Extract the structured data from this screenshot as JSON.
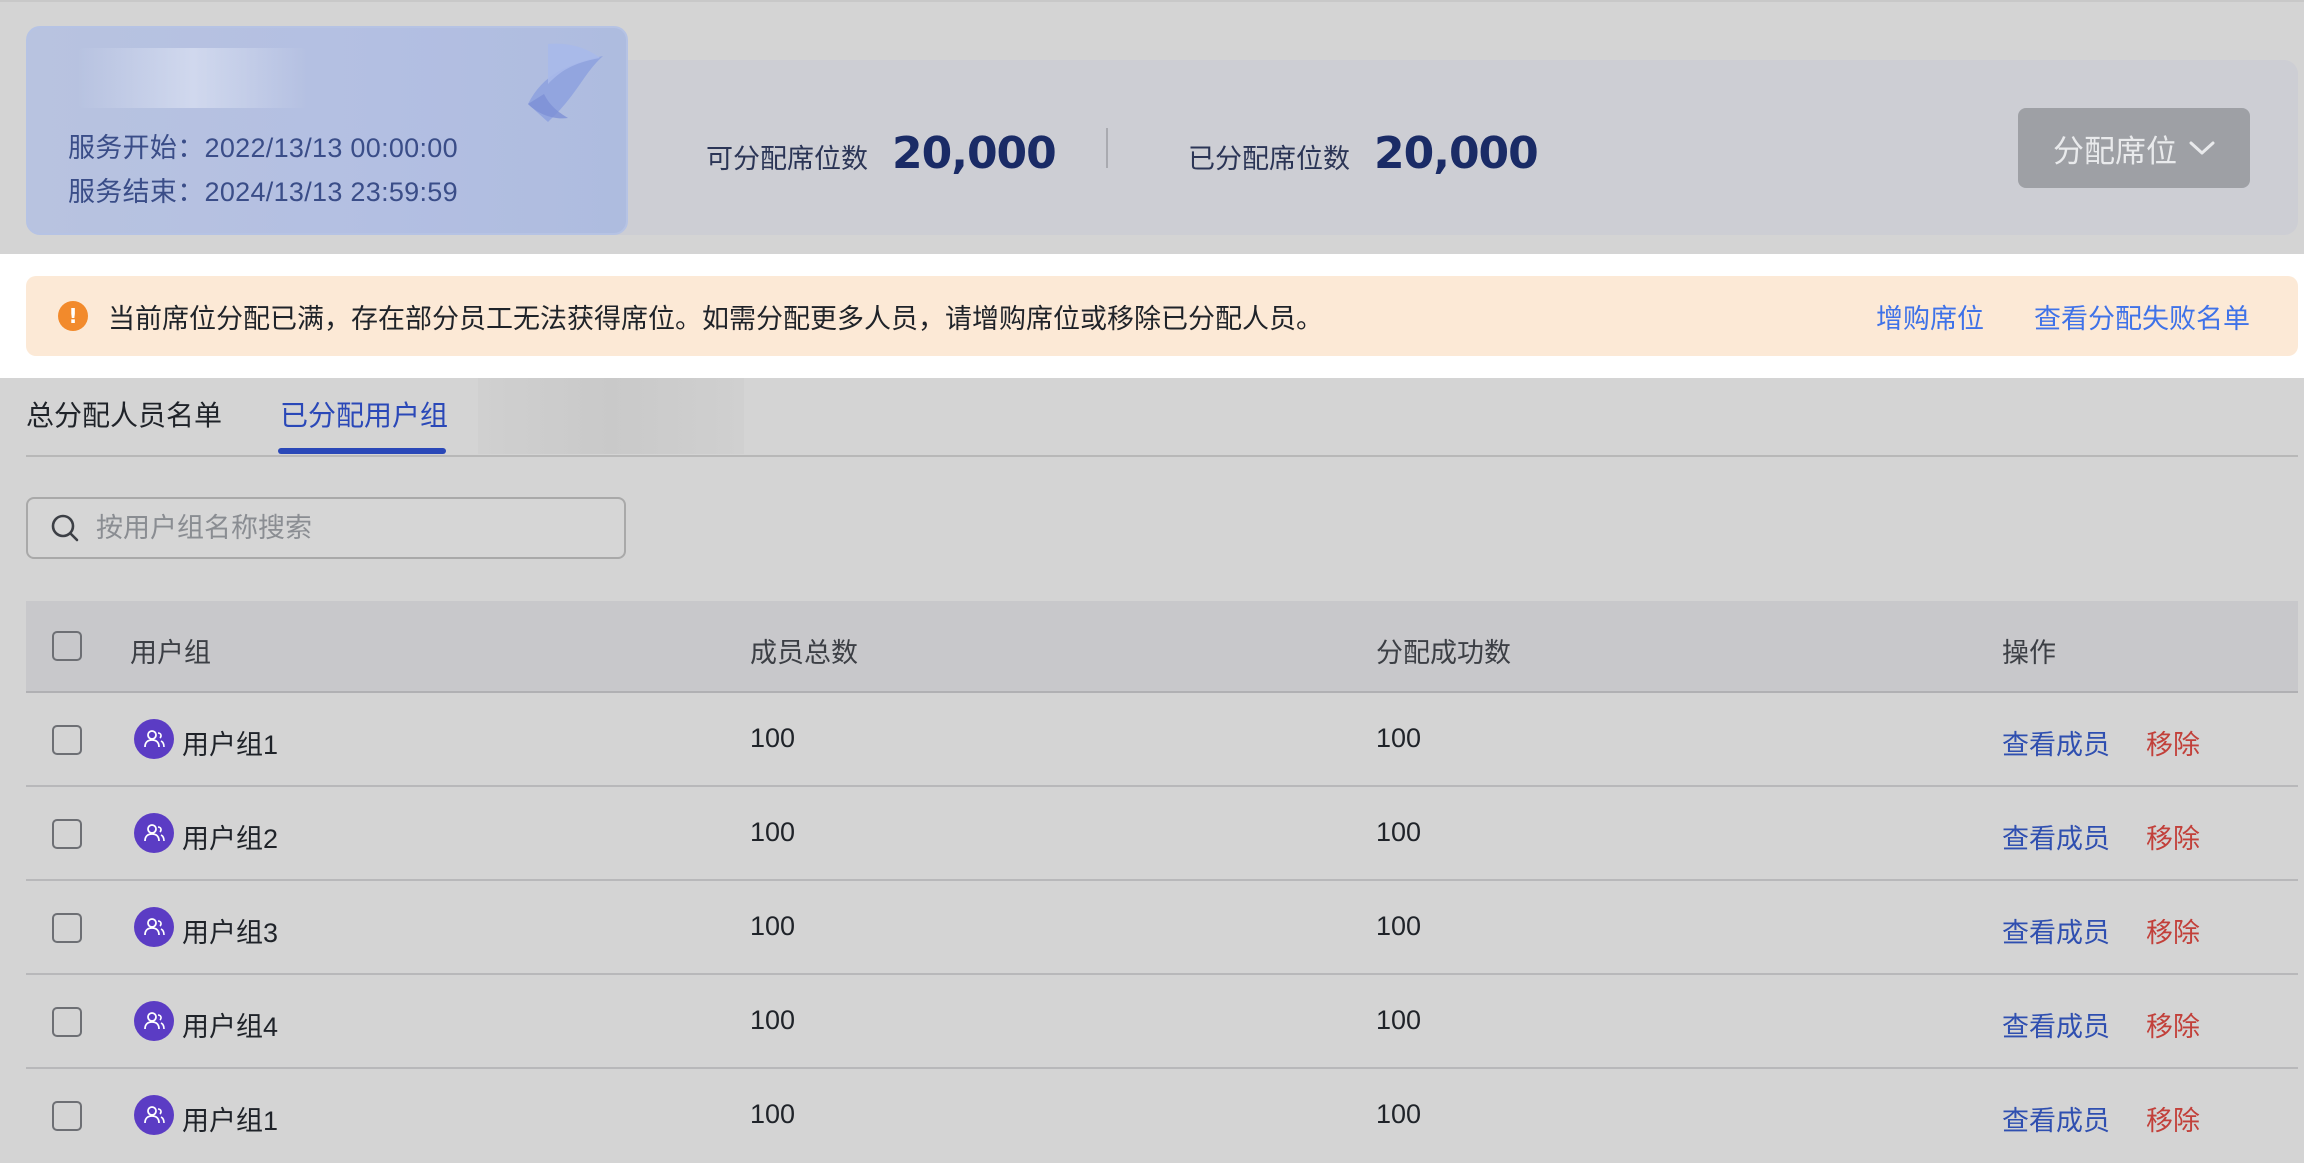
{
  "service": {
    "start": "服务开始：2022/13/13 00:00:00",
    "end": "服务结束：2024/13/13 23:59:59"
  },
  "stats": {
    "assignable_label": "可分配席位数",
    "assignable_value": "20,000",
    "assigned_label": "已分配席位数",
    "assigned_value": "20,000"
  },
  "assign_button": {
    "label": "分配席位",
    "icon": "chevron-down-icon"
  },
  "alert": {
    "icon": "warning-icon",
    "text": "当前席位分配已满，存在部分员工无法获得席位。如需分配更多人员，请增购席位或移除已分配人员。",
    "link_buy": "增购席位",
    "link_failed": "查看分配失败名单"
  },
  "tabs": [
    {
      "label": "总分配人员名单",
      "active": false
    },
    {
      "label": "已分配用户组",
      "active": true
    }
  ],
  "search": {
    "placeholder": "按用户组名称搜索",
    "value": ""
  },
  "table": {
    "headers": [
      "用户组",
      "成员总数",
      "分配成功数",
      "操作"
    ],
    "rows": [
      {
        "name": "用户组1",
        "total": "100",
        "success": "100",
        "view": "查看成员",
        "remove": "移除"
      },
      {
        "name": "用户组2",
        "total": "100",
        "success": "100",
        "view": "查看成员",
        "remove": "移除"
      },
      {
        "name": "用户组3",
        "total": "100",
        "success": "100",
        "view": "查看成员",
        "remove": "移除"
      },
      {
        "name": "用户组4",
        "total": "100",
        "success": "100",
        "view": "查看成员",
        "remove": "移除"
      },
      {
        "name": "用户组1",
        "total": "100",
        "success": "100",
        "view": "查看成员",
        "remove": "移除"
      }
    ]
  },
  "colors": {
    "accent": "#2a48b8",
    "link": "#3f72e8",
    "danger": "#c2403a",
    "warning": "#f28a2c",
    "avatar": "#5b3cc4"
  }
}
